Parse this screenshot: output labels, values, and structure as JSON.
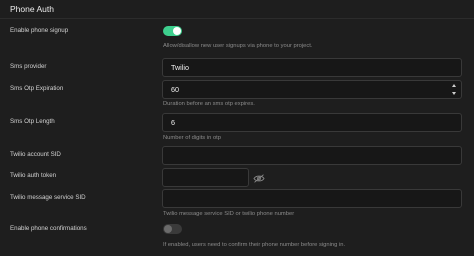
{
  "section": {
    "title": "Phone Auth"
  },
  "enable_signup": {
    "label": "Enable phone signup",
    "enabled": true,
    "help": "Allow/disallow new user signups via phone to your project."
  },
  "sms_provider": {
    "label": "Sms provider",
    "value": "Twilio"
  },
  "otp_expiration": {
    "label": "Sms Otp Expiration",
    "value": "60",
    "help": "Duration before an sms otp expires."
  },
  "otp_length": {
    "label": "Sms Otp Length",
    "value": "6",
    "help": "Number of digits in otp"
  },
  "account_sid": {
    "label": "Twilio account SID",
    "value": ""
  },
  "auth_token": {
    "label": "Twilio auth token",
    "value": "",
    "icon": "eye-off-icon"
  },
  "message_service_sid": {
    "label": "Twilio message service SID",
    "value": "",
    "help": "Twilio message service SID or twilio phone number"
  },
  "phone_confirmations": {
    "label": "Enable phone confirmations",
    "enabled": false,
    "help": "If enabled, users need to confirm their phone number before signing in."
  },
  "colors": {
    "background": "#1e1e1e",
    "toggle_on": "#3ecf8e",
    "input_bg": "#171717",
    "input_border": "#393939"
  }
}
